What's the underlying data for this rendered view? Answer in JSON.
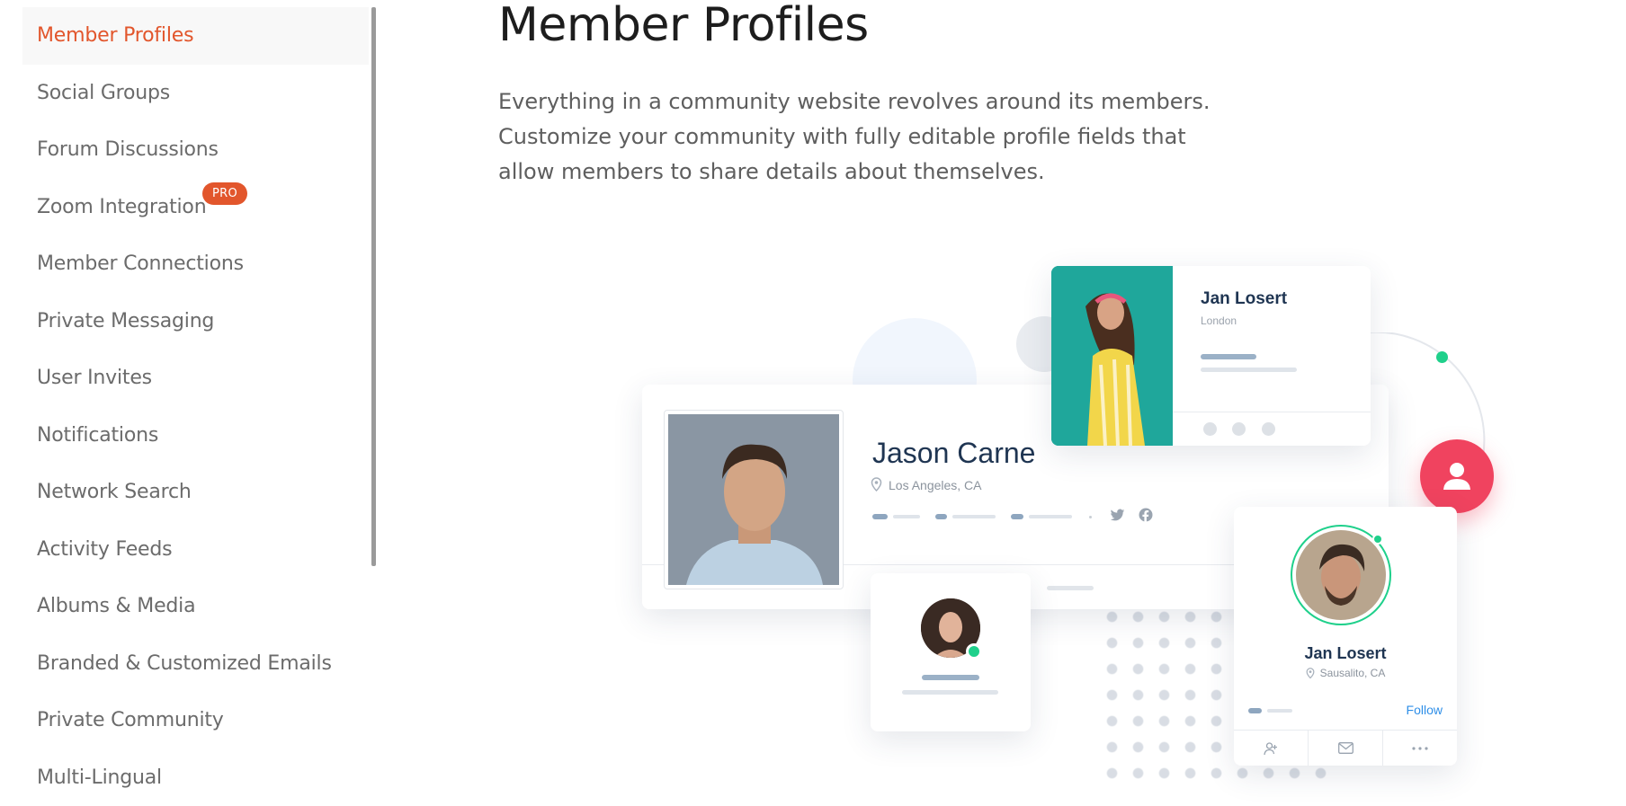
{
  "sidebar": {
    "items": [
      {
        "label": "Member Profiles",
        "active": true
      },
      {
        "label": "Social Groups"
      },
      {
        "label": "Forum Discussions"
      },
      {
        "label": "Zoom Integration",
        "badge": "PRO"
      },
      {
        "label": "Member Connections"
      },
      {
        "label": "Private Messaging"
      },
      {
        "label": "User Invites"
      },
      {
        "label": "Notifications"
      },
      {
        "label": "Network Search"
      },
      {
        "label": "Activity Feeds"
      },
      {
        "label": "Albums & Media"
      },
      {
        "label": "Branded & Customized Emails"
      },
      {
        "label": "Private Community"
      },
      {
        "label": "Multi-Lingual"
      }
    ]
  },
  "main": {
    "title": "Member Profiles",
    "description": "Everything in a community website revolves around its members. Customize your community with fully editable profile fields that allow members to share details about themselves."
  },
  "illustration": {
    "profile_card": {
      "name": "Jason Carne",
      "location": "Los Angeles, CA",
      "icons": [
        "twitter-icon",
        "facebook-icon"
      ]
    },
    "top_card": {
      "name": "Jan Losert",
      "location": "London"
    },
    "member_card": {
      "name": "Jan Losert",
      "location": "Sausalito, CA",
      "follow_label": "Follow",
      "actions": [
        "add-friend-icon",
        "mail-icon",
        "more-icon"
      ]
    }
  },
  "colors": {
    "accent": "#e2562c",
    "online_green": "#1fd08b",
    "avatar_fab": "#f0435f",
    "follow_blue": "#2f8fe8",
    "name_navy": "#1f3552"
  }
}
